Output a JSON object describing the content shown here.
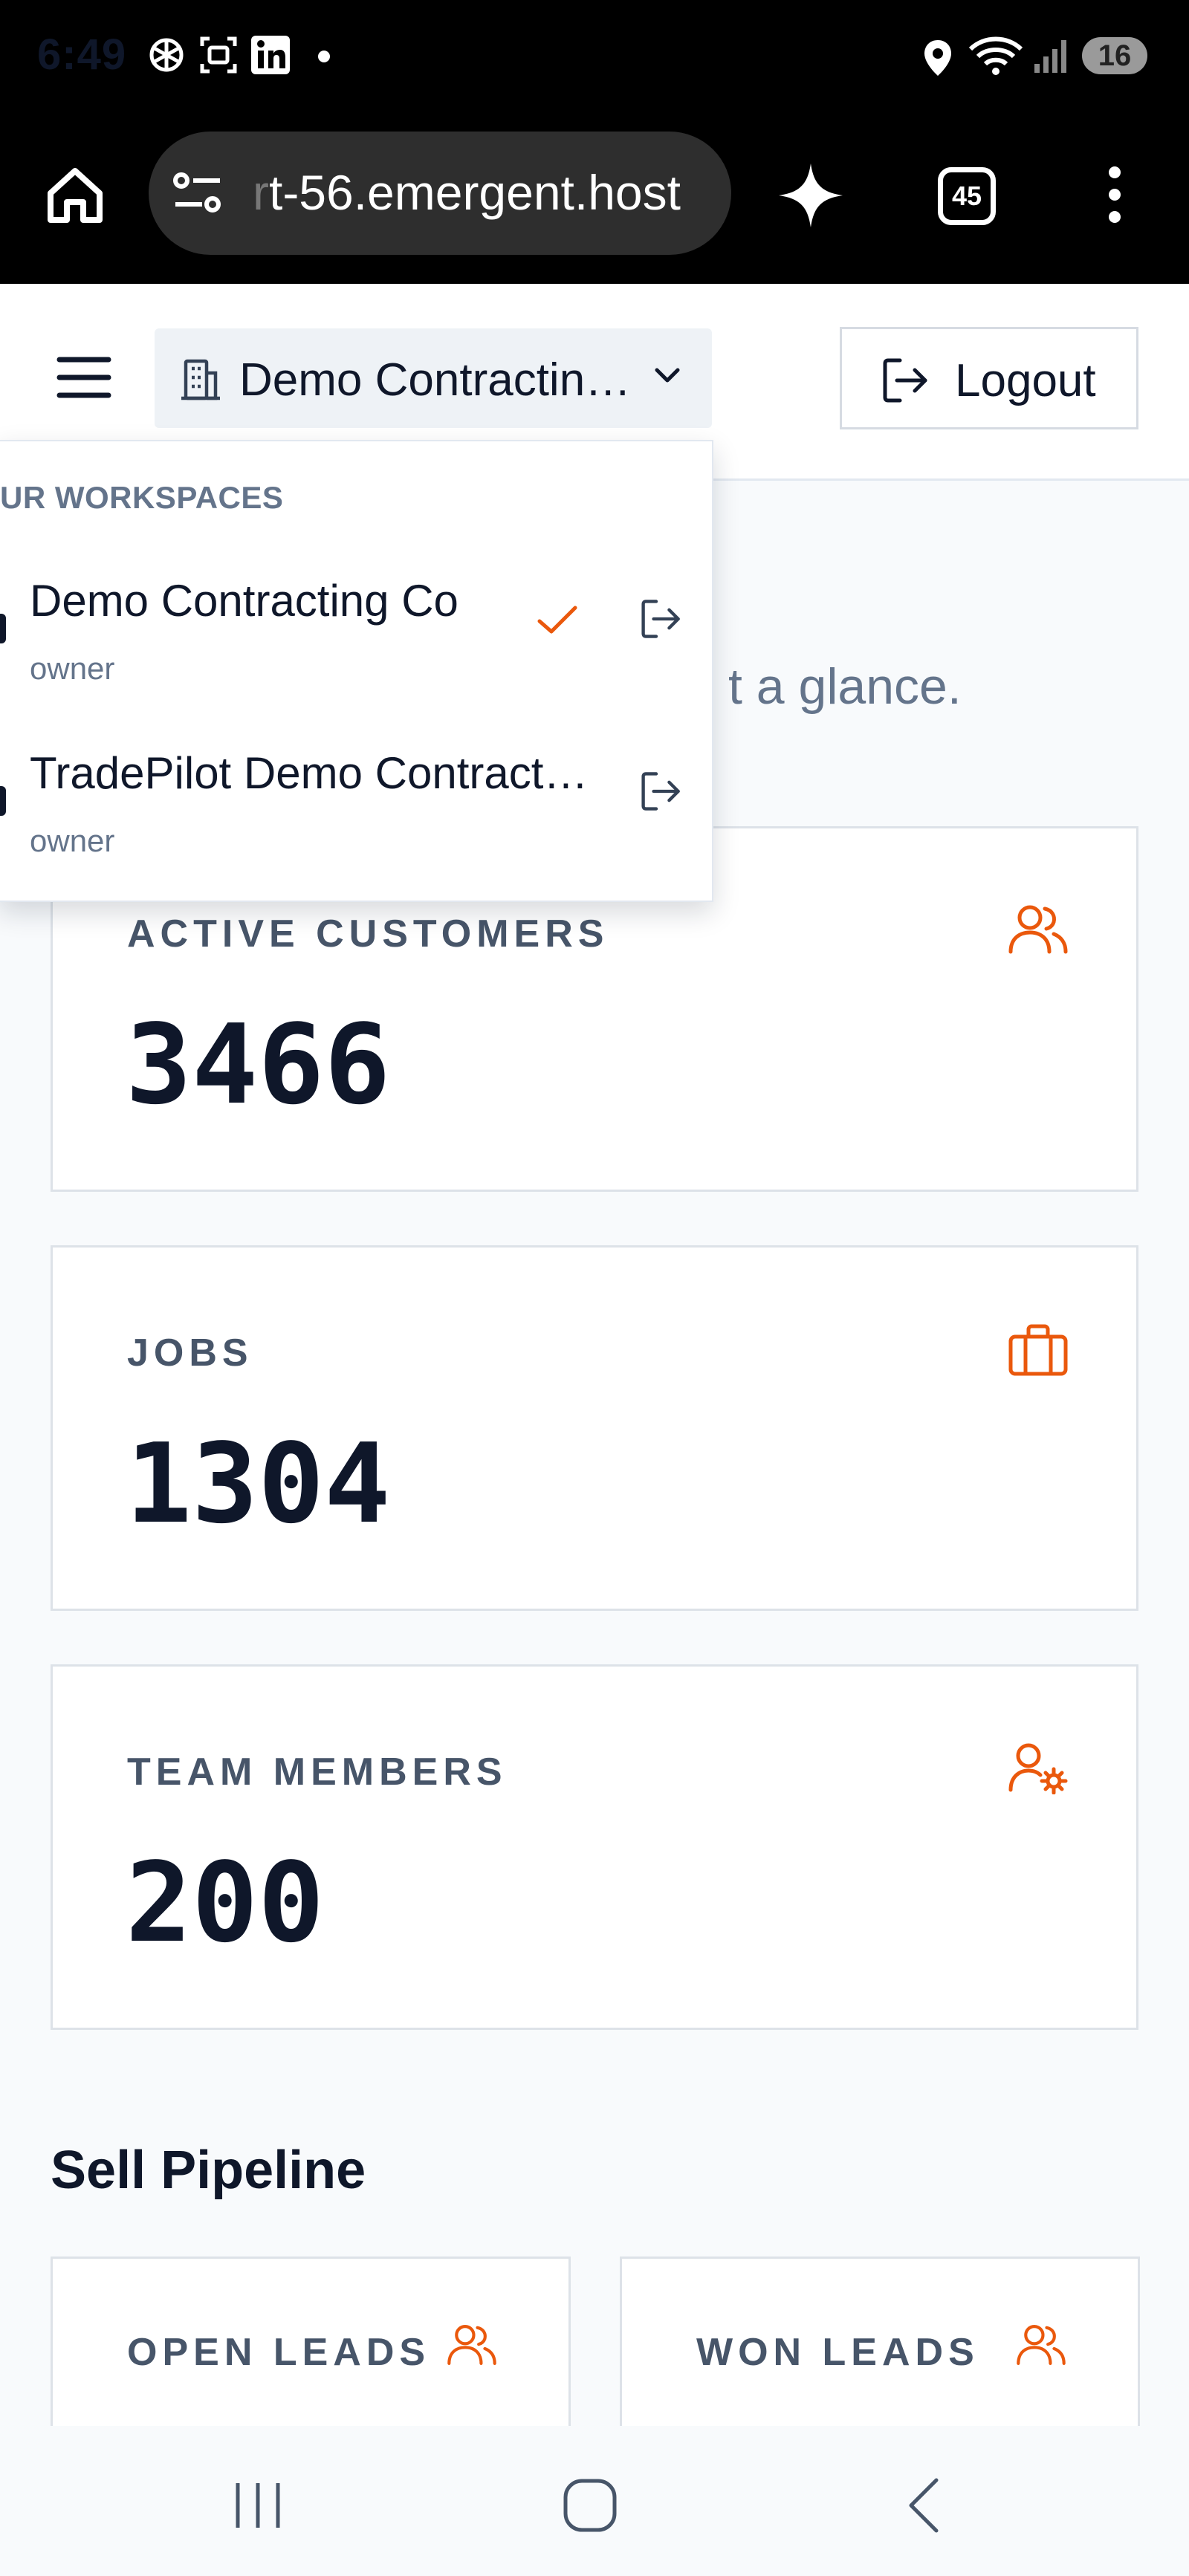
{
  "status_bar": {
    "time": "6:49",
    "battery": "16"
  },
  "browser": {
    "url_faded": "r",
    "url": "t-56.emergent.host",
    "tab_count": "45"
  },
  "header": {
    "workspace_name": "Demo Contractin…",
    "logout_label": "Logout"
  },
  "page": {
    "subtitle_fragment": "t a glance."
  },
  "dropdown": {
    "heading": "UR WORKSPACES",
    "items": [
      {
        "name": "Demo Contracting Co",
        "role": "owner",
        "selected": true
      },
      {
        "name": "TradePilot Demo Contract…",
        "role": "owner",
        "selected": false
      }
    ]
  },
  "stats": [
    {
      "label": "ACTIVE CUSTOMERS",
      "value": "3466",
      "icon": "users-icon"
    },
    {
      "label": "JOBS",
      "value": "1304",
      "icon": "briefcase-icon"
    },
    {
      "label": "TEAM MEMBERS",
      "value": "200",
      "icon": "user-gear-icon"
    }
  ],
  "pipeline": {
    "title": "Sell Pipeline",
    "cards": [
      {
        "label": "OPEN LEADS",
        "icon": "users-icon"
      },
      {
        "label": "WON LEADS",
        "icon": "users-icon"
      }
    ]
  },
  "colors": {
    "accent": "#ea580c",
    "text": "#0f172a",
    "muted": "#64748b",
    "background": "#f8fafc"
  }
}
